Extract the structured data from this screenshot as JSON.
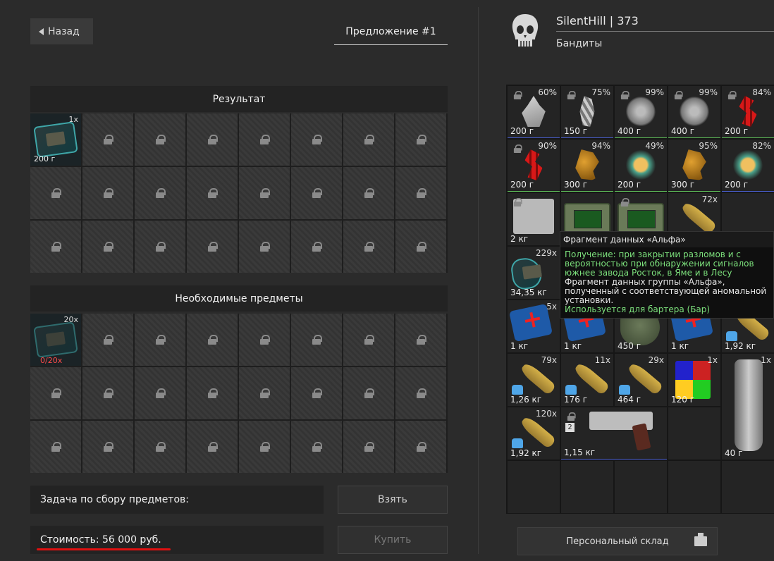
{
  "back_label": "Назад",
  "offer_title": "Предложение #1",
  "result": {
    "heading": "Результат",
    "item": {
      "qty": "1x",
      "weight": "200 г"
    }
  },
  "required": {
    "heading": "Необходимые предметы",
    "item": {
      "qty": "20x",
      "count": "0/20x"
    }
  },
  "task_label": "Задача по сбору предметов:",
  "cost_label": "Стоимость: 56 000  руб.",
  "take_label": "Взять",
  "buy_label": "Купить",
  "player": {
    "name": "SilentHill  |  373",
    "faction": "Бандиты"
  },
  "inventory": [
    {
      "pct": "60%",
      "weight": "200 г"
    },
    {
      "pct": "75%",
      "weight": "150 г"
    },
    {
      "pct": "99%",
      "weight": "400 г"
    },
    {
      "pct": "99%",
      "weight": "400 г"
    },
    {
      "pct": "84%",
      "weight": "200 г"
    },
    {
      "pct": "90%",
      "weight": "200 г"
    },
    {
      "pct": "94%",
      "weight": "300 г"
    },
    {
      "pct": "49%",
      "weight": "200 г"
    },
    {
      "pct": "95%",
      "weight": "300 г"
    },
    {
      "pct": "82%",
      "weight": "200 г"
    },
    {
      "weight": "2 кг"
    },
    {
      "qty": "72x"
    },
    {
      "qty": "229x",
      "weight": "34,35 кг"
    },
    {
      "qty": "5x",
      "weight": "1 кг"
    },
    {
      "weight": "1 кг"
    },
    {
      "weight": "450 г"
    },
    {
      "weight": "1 кг"
    },
    {
      "weight": "1,92 кг"
    },
    {
      "qty": "79x",
      "weight": "1,26 кг"
    },
    {
      "qty": "11x",
      "weight": "176 г"
    },
    {
      "qty": "29x",
      "weight": "464 г"
    },
    {
      "qty": "1x",
      "weight": "120 г"
    },
    {
      "qty": "1x",
      "weight": "40 г"
    },
    {
      "qty": "120x",
      "weight": "1,92 кг"
    },
    {
      "badge": "2",
      "weight": "1,15 кг"
    }
  ],
  "tooltip": {
    "title": "Фрагмент данных «Альфа»",
    "source": "Получение: при закрытии разломов и с вероятностью при обнаружении сигналов южнее завода Росток, в Яме и в Лесу",
    "description": "Фрагмент данных группы «Альфа», полученный с соответствующей аномальной установки.",
    "usage": "Используется для бартера (Бар)"
  },
  "storage_label": "Персональный склад"
}
